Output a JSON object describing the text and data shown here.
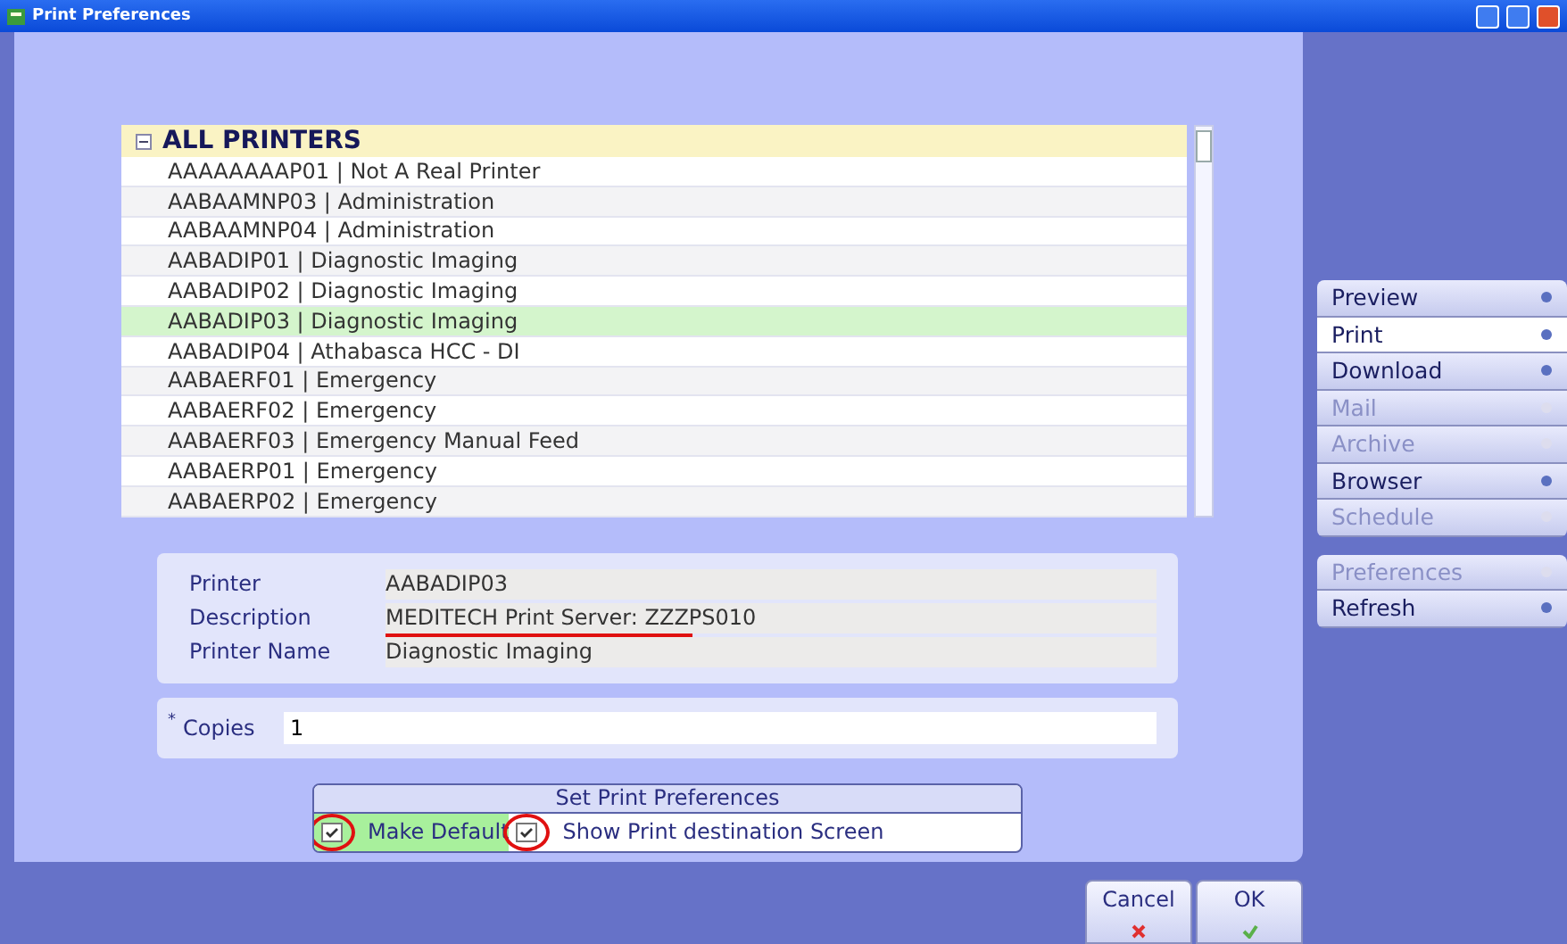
{
  "window": {
    "title": "Print Preferences"
  },
  "printer_list": {
    "header": "ALL PRINTERS",
    "expanded": true,
    "rows": [
      {
        "label": "AAAAAAAAP01 | Not A Real Printer",
        "selected": false
      },
      {
        "label": "AABAAMNP03 | Administration",
        "selected": false
      },
      {
        "label": "AABAAMNP04 | Administration",
        "selected": false
      },
      {
        "label": "AABADIP01 | Diagnostic Imaging",
        "selected": false
      },
      {
        "label": "AABADIP02 | Diagnostic Imaging",
        "selected": false
      },
      {
        "label": "AABADIP03 | Diagnostic Imaging",
        "selected": true
      },
      {
        "label": "AABADIP04 | Athabasca HCC - DI",
        "selected": false
      },
      {
        "label": "AABAERF01 | Emergency",
        "selected": false
      },
      {
        "label": "AABAERF02 | Emergency",
        "selected": false
      },
      {
        "label": "AABAERF03 | Emergency Manual Feed",
        "selected": false
      },
      {
        "label": "AABAERP01 | Emergency",
        "selected": false
      },
      {
        "label": "AABAERP02 | Emergency",
        "selected": false
      }
    ]
  },
  "details": [
    {
      "label": "Printer",
      "value": "AABADIP03"
    },
    {
      "label": "Description",
      "value": "MEDITECH Print Server: ZZZPS010"
    },
    {
      "label": "Printer Name",
      "value": "Diagnostic Imaging"
    }
  ],
  "copies": {
    "required_mark": "*",
    "label": "Copies",
    "value": "1"
  },
  "preferences": {
    "title": "Set Print Preferences",
    "options": [
      {
        "label": "Make Default",
        "checked": true,
        "highlighted": true
      },
      {
        "label": "Show Print destination Screen",
        "checked": true,
        "highlighted": false
      }
    ]
  },
  "sidebar": {
    "groups": [
      [
        {
          "label": "Preview",
          "disabled": false,
          "selected": false
        },
        {
          "label": "Print",
          "disabled": false,
          "selected": true
        },
        {
          "label": "Download",
          "disabled": false,
          "selected": false
        },
        {
          "label": "Mail",
          "disabled": true,
          "selected": false
        },
        {
          "label": "Archive",
          "disabled": true,
          "selected": false
        },
        {
          "label": "Browser",
          "disabled": false,
          "selected": false
        },
        {
          "label": "Schedule",
          "disabled": true,
          "selected": false
        }
      ],
      [
        {
          "label": "Preferences",
          "disabled": true,
          "selected": false
        },
        {
          "label": "Refresh",
          "disabled": false,
          "selected": false
        }
      ]
    ]
  },
  "buttons": [
    {
      "label": "Cancel",
      "kind": "cancel"
    },
    {
      "label": "OK",
      "kind": "ok"
    }
  ]
}
